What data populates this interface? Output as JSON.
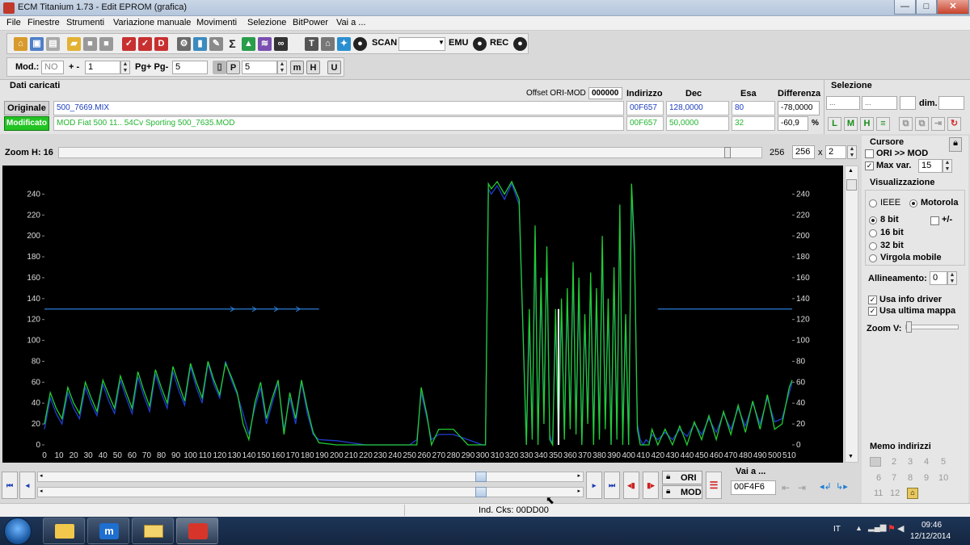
{
  "window": {
    "title": "ECM Titanium 1.73 - Edit EPROM (grafica)",
    "min_glyph": "—",
    "max_glyph": "□",
    "close_glyph": "✕"
  },
  "menu": [
    "File",
    "Finestre",
    "Strumenti",
    "Variazione manuale",
    "Movimenti",
    "Selezione",
    "BitPower",
    "Vai a ..."
  ],
  "toolbar1": {
    "scan_label": "SCAN",
    "emu_label": "EMU",
    "rec_label": "REC",
    "sigma": "Σ"
  },
  "toolbar2": {
    "mod_label": "Mod.:",
    "mod_value": "NO",
    "plusminus_label": "+ -",
    "plusminus_value": "1",
    "pg_label": "Pg+ Pg-",
    "pg_value": "5",
    "p_value": "5"
  },
  "data_panel": {
    "heading": "Dati caricati",
    "offset_label": "Offset ORI-MOD",
    "offset_value": "000000",
    "col_indirizzo": "Indirizzo",
    "col_dec": "Dec",
    "col_esa": "Esa",
    "col_diff": "Differenza",
    "original": {
      "label": "Originale",
      "file": "500_7669.MIX",
      "indirizzo": "00F657",
      "dec": "128,0000",
      "esa": "80",
      "diff": "-78,0000"
    },
    "modified": {
      "label": "Modificato",
      "file": "MOD Fiat 500 11.. 54Cv Sporting 500_7635.MOD",
      "indirizzo": "00F657",
      "dec": "50,0000",
      "esa": "32",
      "diff": "-60,9",
      "percent": "%"
    },
    "selezione_heading": "Selezione",
    "sel_a": "...",
    "sel_b": "...",
    "dim_label": "dim."
  },
  "zoom": {
    "label": "Zoom H: 16",
    "value_right": "256",
    "field_value": "256",
    "x_label": "x",
    "mult": "2",
    "zoom_position": 0.95
  },
  "right_panel": {
    "cursore_heading": "Cursore",
    "ori_mod_label": "ORI >> MOD",
    "max_var_label": "Max var.",
    "max_var_value": "15",
    "visual_heading": "Visualizzazione",
    "ieee": "IEEE",
    "motorola": "Motorola",
    "bit8": "8 bit",
    "plusminus": "+/-",
    "bit16": "16 bit",
    "bit32": "32 bit",
    "virgola": "Virgola mobile",
    "allineamento_label": "Allineamento:",
    "allineamento_value": "0",
    "usa_info": "Usa info driver",
    "usa_ultima": "Usa ultima mappa",
    "zoom_v": "Zoom V:",
    "memo_heading": "Memo indirizzi",
    "memo_numbers": [
      "2",
      "3",
      "4",
      "5",
      "6",
      "7",
      "8",
      "9",
      "10",
      "11",
      "12"
    ]
  },
  "bottom": {
    "ori_label": "ORI",
    "mod_label": "MOD",
    "vai_label": "Vai a ...",
    "vai_value": "00F4F6",
    "status": "Ind. Cks: 00DD00",
    "scroll_top_position": 0.81,
    "scroll_bottom_position": 0.81
  },
  "taskbar": {
    "lang": "IT",
    "time": "09:46",
    "date": "12/12/2014"
  },
  "colors": {
    "original_series": "#1f3fd0",
    "modified_series": "#22cc33",
    "cursor": "#ffffff",
    "max_var_line": "#2a7fd6"
  },
  "chart_data": {
    "type": "line",
    "y_ticks": [
      0,
      20,
      40,
      60,
      80,
      100,
      120,
      140,
      160,
      180,
      200,
      220,
      240
    ],
    "x_ticks": [
      0,
      10,
      20,
      30,
      40,
      50,
      60,
      70,
      80,
      90,
      100,
      110,
      120,
      130,
      140,
      150,
      160,
      170,
      180,
      190,
      200,
      210,
      220,
      230,
      240,
      250,
      260,
      270,
      280,
      290,
      300,
      310,
      320,
      330,
      340,
      350,
      360,
      370,
      380,
      390,
      400,
      410,
      420,
      430,
      440,
      450,
      460,
      470,
      480,
      490,
      500,
      510
    ],
    "xlim": [
      0,
      512
    ],
    "ylim": [
      0,
      255
    ],
    "grid": false,
    "cursor_x": 352,
    "max_var_level": 130,
    "series": [
      {
        "x": [
          0,
          4,
          8,
          12,
          16,
          20,
          24,
          28,
          32,
          36,
          40,
          44,
          48,
          52,
          56,
          60,
          64,
          68,
          72,
          76,
          80,
          84,
          88,
          92,
          96,
          100,
          104,
          108,
          112,
          116,
          120,
          124,
          128,
          132,
          136,
          140,
          144,
          148,
          152,
          156,
          160,
          164,
          168,
          172,
          176,
          180,
          184,
          188,
          200,
          210,
          220,
          230,
          240,
          250,
          255,
          258,
          262,
          265,
          270,
          280,
          290,
          300,
          302,
          304,
          306,
          310,
          315,
          320,
          325,
          330,
          332,
          334,
          336,
          338,
          340,
          342,
          344,
          346,
          348,
          350,
          352,
          354,
          356,
          358,
          360,
          362,
          364,
          366,
          368,
          370,
          372,
          374,
          376,
          378,
          380,
          382,
          384,
          386,
          388,
          390,
          392,
          394,
          396,
          398,
          400,
          402,
          404,
          406,
          408,
          410,
          412,
          414,
          416,
          420,
          425,
          430,
          435,
          440,
          445,
          450,
          455,
          460,
          465,
          470,
          475,
          480,
          485,
          490,
          495,
          500,
          505,
          510,
          512
        ],
        "y": [
          15,
          45,
          30,
          20,
          50,
          35,
          25,
          55,
          40,
          28,
          58,
          42,
          30,
          62,
          45,
          30,
          65,
          47,
          32,
          68,
          50,
          35,
          70,
          52,
          38,
          75,
          55,
          40,
          78,
          58,
          45,
          80,
          62,
          48,
          30,
          10,
          35,
          55,
          20,
          40,
          60,
          15,
          45,
          20,
          60,
          30,
          10,
          5,
          4,
          2,
          0,
          0,
          0,
          0,
          5,
          50,
          25,
          5,
          10,
          10,
          5,
          0,
          0,
          245,
          240,
          248,
          235,
          250,
          230,
          0,
          120,
          10,
          200,
          5,
          150,
          30,
          180,
          10,
          0,
          120,
          0,
          130,
          10,
          140,
          20,
          170,
          15,
          150,
          0,
          120,
          25,
          160,
          5,
          140,
          10,
          190,
          20,
          130,
          0,
          160,
          10,
          220,
          5,
          120,
          0,
          245,
          180,
          20,
          5,
          0,
          5,
          2,
          10,
          5,
          12,
          5,
          15,
          8,
          20,
          10,
          25,
          12,
          30,
          15,
          35,
          18,
          40,
          20,
          45,
          22,
          25,
          50,
          60
        ]
      },
      {
        "x": [
          0,
          4,
          8,
          12,
          16,
          20,
          24,
          28,
          32,
          36,
          40,
          44,
          48,
          52,
          56,
          60,
          64,
          68,
          72,
          76,
          80,
          84,
          88,
          92,
          96,
          100,
          104,
          108,
          112,
          116,
          120,
          124,
          128,
          132,
          136,
          140,
          144,
          148,
          152,
          156,
          160,
          164,
          168,
          172,
          176,
          180,
          184,
          188,
          200,
          210,
          220,
          230,
          240,
          250,
          255,
          258,
          262,
          265,
          270,
          280,
          290,
          300,
          302,
          304,
          306,
          310,
          315,
          320,
          325,
          330,
          332,
          334,
          336,
          338,
          340,
          342,
          344,
          346,
          348,
          350,
          352,
          354,
          356,
          358,
          360,
          362,
          364,
          366,
          368,
          370,
          372,
          374,
          376,
          378,
          380,
          382,
          384,
          386,
          388,
          390,
          392,
          394,
          396,
          398,
          400,
          402,
          404,
          406,
          408,
          410,
          412,
          414,
          416,
          420,
          425,
          430,
          435,
          440,
          445,
          450,
          455,
          460,
          465,
          470,
          475,
          480,
          485,
          490,
          495,
          500,
          505,
          510,
          512
        ],
        "y": [
          20,
          50,
          35,
          25,
          55,
          40,
          30,
          60,
          45,
          32,
          62,
          48,
          35,
          66,
          50,
          35,
          70,
          52,
          37,
          72,
          55,
          40,
          75,
          58,
          42,
          78,
          60,
          45,
          80,
          62,
          48,
          78,
          65,
          50,
          20,
          5,
          40,
          60,
          25,
          45,
          62,
          10,
          50,
          25,
          62,
          35,
          12,
          2,
          0,
          0,
          0,
          0,
          0,
          0,
          0,
          55,
          28,
          0,
          15,
          15,
          0,
          0,
          0,
          250,
          245,
          252,
          240,
          252,
          235,
          0,
          130,
          5,
          210,
          0,
          160,
          20,
          190,
          5,
          0,
          130,
          0,
          140,
          5,
          150,
          15,
          175,
          10,
          160,
          0,
          125,
          20,
          165,
          0,
          150,
          5,
          200,
          15,
          140,
          0,
          170,
          5,
          230,
          0,
          125,
          0,
          250,
          190,
          15,
          0,
          0,
          0,
          0,
          15,
          0,
          15,
          0,
          18,
          0,
          22,
          5,
          28,
          5,
          32,
          10,
          38,
          12,
          42,
          15,
          48,
          15,
          20,
          55,
          62
        ]
      }
    ]
  }
}
